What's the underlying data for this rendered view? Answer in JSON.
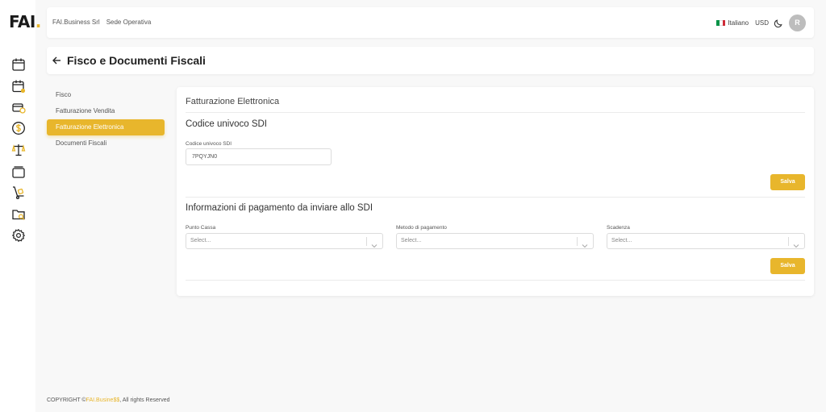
{
  "logo": {
    "text": "FAI",
    "dot": "."
  },
  "rail": {
    "icons": [
      "calendar-icon",
      "calendar-user-icon",
      "wallet-coins-icon",
      "dollar-coin-icon",
      "scale-balance-icon",
      "stack-layers-icon",
      "hand-truck-icon",
      "folder-search-icon",
      "gear-icon"
    ]
  },
  "topbar": {
    "company": "FAI.Business Srl",
    "location": "Sede Operativa",
    "language": "Italiano",
    "currency": "USD",
    "avatar_initial": "R"
  },
  "page": {
    "title": "Fisco e Documenti Fiscali"
  },
  "sidemenu": {
    "items": [
      {
        "label": "Fisco"
      },
      {
        "label": "Fatturazione Vendita"
      },
      {
        "label": "Fatturazione Elettronica"
      },
      {
        "label": "Documenti Fiscali"
      }
    ],
    "active_index": 2
  },
  "card": {
    "title": "Fatturazione Elettronica",
    "sdi_section": {
      "title": "Codice univoco SDI",
      "field_label": "Codice univoco SDI",
      "field_value": "7PQYJN0",
      "save_label": "Salva"
    },
    "payment_section": {
      "title": "Informazioni di pagamento da inviare allo SDI",
      "fields": [
        {
          "label": "Punto Cassa",
          "placeholder": "Select..."
        },
        {
          "label": "Metodo di pagamento",
          "placeholder": "Select..."
        },
        {
          "label": "Scadenza",
          "placeholder": "Select..."
        }
      ],
      "save_label": "Salva"
    }
  },
  "footer": {
    "prefix": "COPYRIGHT ©",
    "brand": "FAI.Busine$$",
    "suffix": ", All rights Reserved"
  },
  "colors": {
    "accent": "#e8b62c",
    "text": "#333333",
    "background": "#f8f8f8"
  }
}
